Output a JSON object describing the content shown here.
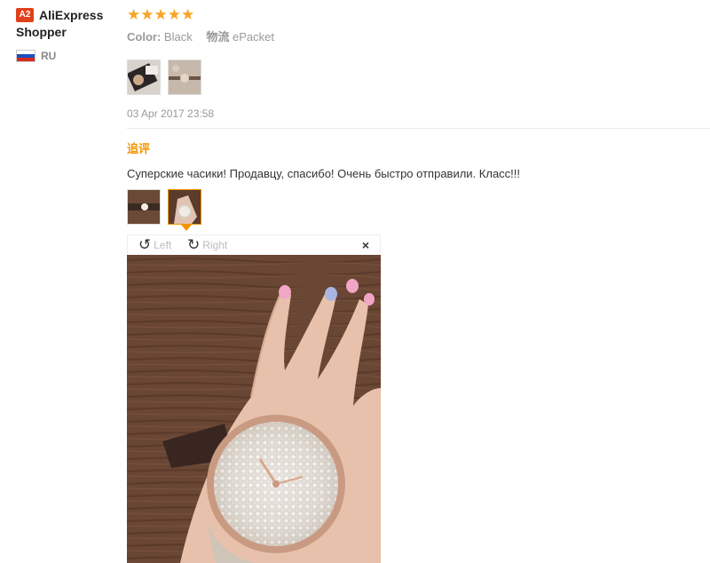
{
  "reviewer": {
    "badge": "A2",
    "name_line1": "AliExpress",
    "name_line2": "Shopper",
    "country": "RU"
  },
  "review": {
    "stars": "★★★★★",
    "color_label": "Color:",
    "color_value": "Black",
    "shipping_label": "物流",
    "shipping_value": "ePacket",
    "date": "03 Apr 2017 23:58"
  },
  "followup": {
    "label": "追评",
    "text": "Суперские часики! Продавцу, спасибо! Очень быстро отправили. Класс!!!"
  },
  "viewer": {
    "rotate_left": "Left",
    "rotate_right": "Right",
    "close": "×"
  },
  "colors": {
    "accent": "#f29400",
    "star": "#f5a623",
    "badge": "#e0411b"
  },
  "icons": [
    "rotate-left-icon",
    "rotate-right-icon",
    "close-icon",
    "russia-flag-icon"
  ]
}
